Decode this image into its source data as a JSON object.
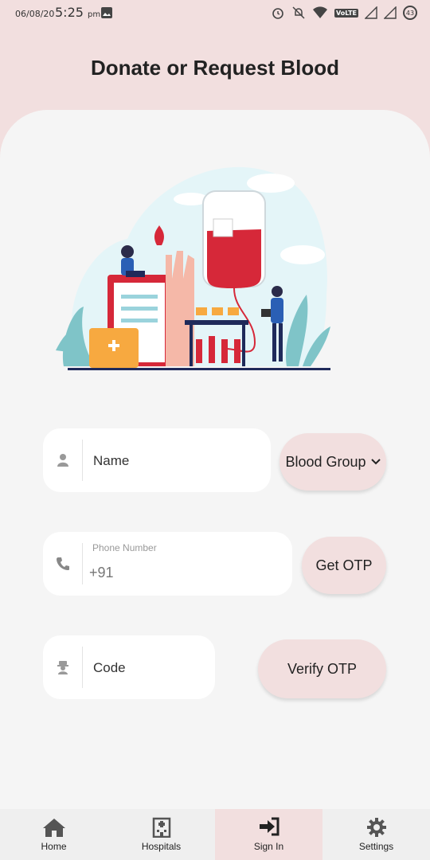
{
  "status_bar": {
    "date": "06/08/20",
    "time": "5:25",
    "ampm": "pm",
    "network": "VoLTE",
    "battery": "43"
  },
  "header": {
    "title": "Donate or Request Blood"
  },
  "form": {
    "name": {
      "placeholder": "Name",
      "icon": "user-icon"
    },
    "blood_group": {
      "label": "Blood Group",
      "icon": "chevron-down-icon"
    },
    "phone": {
      "label": "Phone Number",
      "value": "+91",
      "icon": "phone-icon"
    },
    "get_otp": {
      "label": "Get OTP"
    },
    "code": {
      "placeholder": "Code",
      "icon": "secret-agent-icon"
    },
    "verify_otp": {
      "label": "Verify OTP"
    }
  },
  "nav": {
    "items": [
      {
        "label": "Home",
        "icon": "home-icon"
      },
      {
        "label": "Hospitals",
        "icon": "hospital-icon"
      },
      {
        "label": "Sign In",
        "icon": "sign-in-icon",
        "active": true
      },
      {
        "label": "Settings",
        "icon": "gear-icon"
      }
    ]
  },
  "colors": {
    "accent": "#f2dfdf",
    "sheet": "#f5f5f5",
    "card": "#ffffff",
    "blood": "#d62839"
  }
}
